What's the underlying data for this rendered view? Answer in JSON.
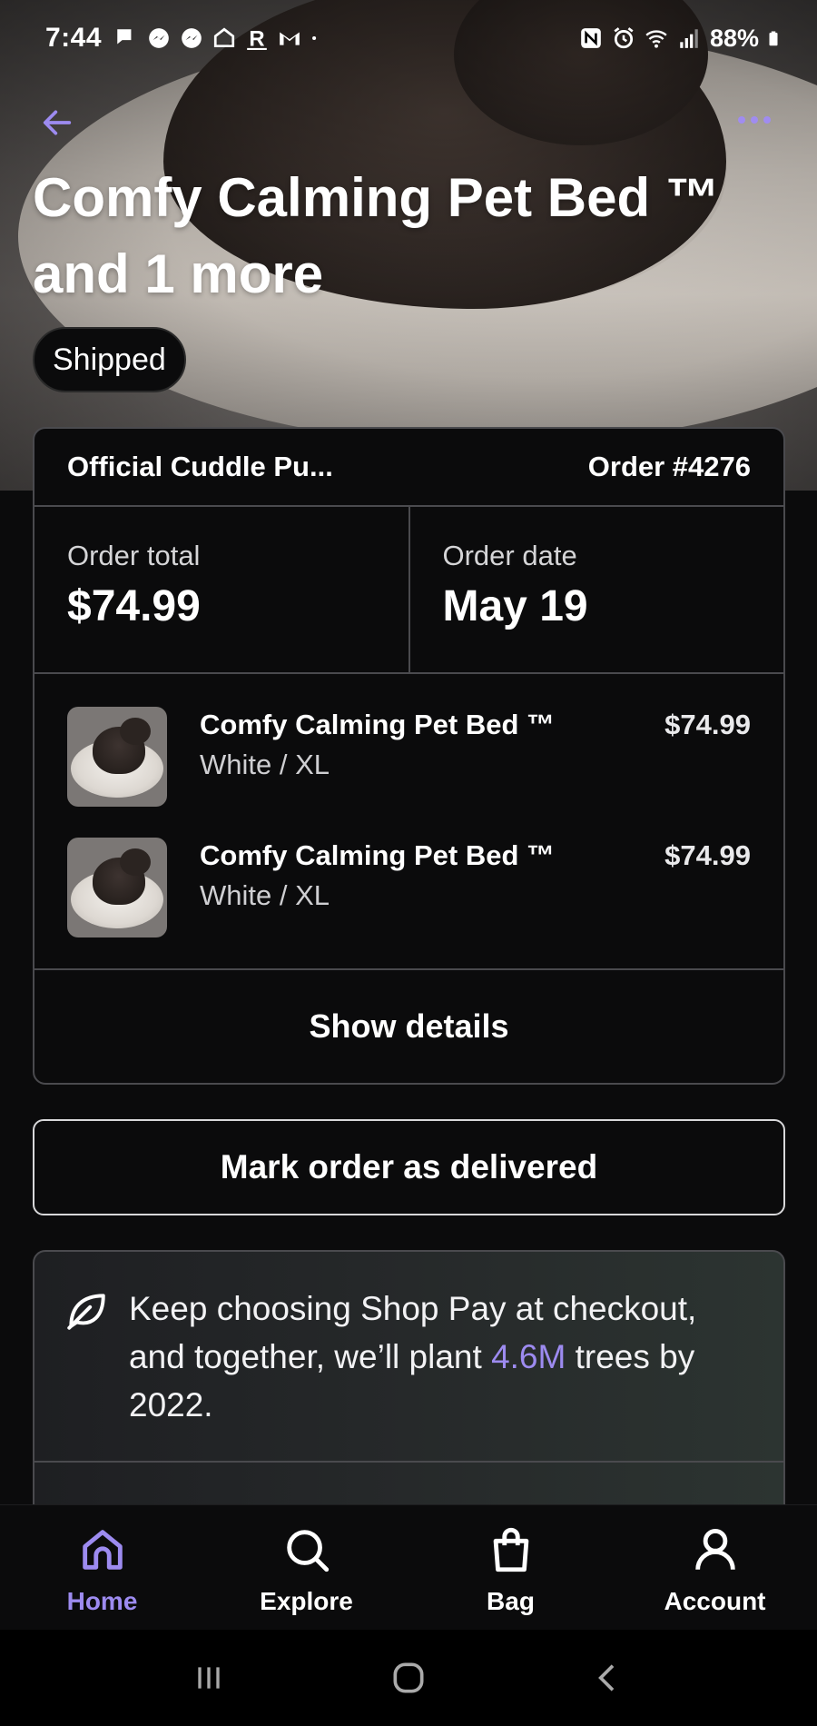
{
  "status_bar": {
    "time": "7:44",
    "battery": "88%"
  },
  "header": {
    "title": "Comfy Calming Pet Bed ™ and 1 more",
    "status_badge": "Shipped"
  },
  "order": {
    "store_name": "Official Cuddle Pu...",
    "order_number": "Order #4276",
    "total_label": "Order total",
    "total_value": "$74.99",
    "date_label": "Order date",
    "date_value": "May 19",
    "items": [
      {
        "name": "Comfy Calming Pet Bed ™",
        "variant": "White / XL",
        "price": "$74.99"
      },
      {
        "name": "Comfy Calming Pet Bed ™",
        "variant": "White / XL",
        "price": "$74.99"
      }
    ],
    "show_details_label": "Show details"
  },
  "actions": {
    "mark_delivered_label": "Mark order as delivered"
  },
  "eco_banner": {
    "text_before": "Keep choosing Shop Pay at checkout, and together, we’ll plant ",
    "highlight": "4.6M",
    "text_after": " trees by 2022.",
    "accent_color": "#9d8bf0"
  },
  "bottom_nav": {
    "items": [
      {
        "label": "Home",
        "icon": "home-icon",
        "active": true
      },
      {
        "label": "Explore",
        "icon": "search-icon",
        "active": false
      },
      {
        "label": "Bag",
        "icon": "bag-icon",
        "active": false
      },
      {
        "label": "Account",
        "icon": "account-icon",
        "active": false
      }
    ]
  },
  "colors": {
    "accent": "#9d8bf0",
    "background": "#0b0b0c",
    "border": "#4a4a4e"
  }
}
